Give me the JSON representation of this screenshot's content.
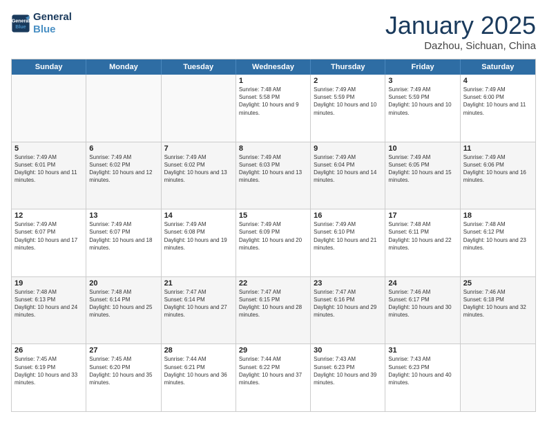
{
  "logo": {
    "line1": "General",
    "line2": "Blue"
  },
  "title": "January 2025",
  "location": "Dazhou, Sichuan, China",
  "header_days": [
    "Sunday",
    "Monday",
    "Tuesday",
    "Wednesday",
    "Thursday",
    "Friday",
    "Saturday"
  ],
  "rows": [
    [
      {
        "day": "",
        "sunrise": "",
        "sunset": "",
        "daylight": ""
      },
      {
        "day": "",
        "sunrise": "",
        "sunset": "",
        "daylight": ""
      },
      {
        "day": "",
        "sunrise": "",
        "sunset": "",
        "daylight": ""
      },
      {
        "day": "1",
        "sunrise": "Sunrise: 7:48 AM",
        "sunset": "Sunset: 5:58 PM",
        "daylight": "Daylight: 10 hours and 9 minutes."
      },
      {
        "day": "2",
        "sunrise": "Sunrise: 7:49 AM",
        "sunset": "Sunset: 5:59 PM",
        "daylight": "Daylight: 10 hours and 10 minutes."
      },
      {
        "day": "3",
        "sunrise": "Sunrise: 7:49 AM",
        "sunset": "Sunset: 5:59 PM",
        "daylight": "Daylight: 10 hours and 10 minutes."
      },
      {
        "day": "4",
        "sunrise": "Sunrise: 7:49 AM",
        "sunset": "Sunset: 6:00 PM",
        "daylight": "Daylight: 10 hours and 11 minutes."
      }
    ],
    [
      {
        "day": "5",
        "sunrise": "Sunrise: 7:49 AM",
        "sunset": "Sunset: 6:01 PM",
        "daylight": "Daylight: 10 hours and 11 minutes."
      },
      {
        "day": "6",
        "sunrise": "Sunrise: 7:49 AM",
        "sunset": "Sunset: 6:02 PM",
        "daylight": "Daylight: 10 hours and 12 minutes."
      },
      {
        "day": "7",
        "sunrise": "Sunrise: 7:49 AM",
        "sunset": "Sunset: 6:02 PM",
        "daylight": "Daylight: 10 hours and 13 minutes."
      },
      {
        "day": "8",
        "sunrise": "Sunrise: 7:49 AM",
        "sunset": "Sunset: 6:03 PM",
        "daylight": "Daylight: 10 hours and 13 minutes."
      },
      {
        "day": "9",
        "sunrise": "Sunrise: 7:49 AM",
        "sunset": "Sunset: 6:04 PM",
        "daylight": "Daylight: 10 hours and 14 minutes."
      },
      {
        "day": "10",
        "sunrise": "Sunrise: 7:49 AM",
        "sunset": "Sunset: 6:05 PM",
        "daylight": "Daylight: 10 hours and 15 minutes."
      },
      {
        "day": "11",
        "sunrise": "Sunrise: 7:49 AM",
        "sunset": "Sunset: 6:06 PM",
        "daylight": "Daylight: 10 hours and 16 minutes."
      }
    ],
    [
      {
        "day": "12",
        "sunrise": "Sunrise: 7:49 AM",
        "sunset": "Sunset: 6:07 PM",
        "daylight": "Daylight: 10 hours and 17 minutes."
      },
      {
        "day": "13",
        "sunrise": "Sunrise: 7:49 AM",
        "sunset": "Sunset: 6:07 PM",
        "daylight": "Daylight: 10 hours and 18 minutes."
      },
      {
        "day": "14",
        "sunrise": "Sunrise: 7:49 AM",
        "sunset": "Sunset: 6:08 PM",
        "daylight": "Daylight: 10 hours and 19 minutes."
      },
      {
        "day": "15",
        "sunrise": "Sunrise: 7:49 AM",
        "sunset": "Sunset: 6:09 PM",
        "daylight": "Daylight: 10 hours and 20 minutes."
      },
      {
        "day": "16",
        "sunrise": "Sunrise: 7:49 AM",
        "sunset": "Sunset: 6:10 PM",
        "daylight": "Daylight: 10 hours and 21 minutes."
      },
      {
        "day": "17",
        "sunrise": "Sunrise: 7:48 AM",
        "sunset": "Sunset: 6:11 PM",
        "daylight": "Daylight: 10 hours and 22 minutes."
      },
      {
        "day": "18",
        "sunrise": "Sunrise: 7:48 AM",
        "sunset": "Sunset: 6:12 PM",
        "daylight": "Daylight: 10 hours and 23 minutes."
      }
    ],
    [
      {
        "day": "19",
        "sunrise": "Sunrise: 7:48 AM",
        "sunset": "Sunset: 6:13 PM",
        "daylight": "Daylight: 10 hours and 24 minutes."
      },
      {
        "day": "20",
        "sunrise": "Sunrise: 7:48 AM",
        "sunset": "Sunset: 6:14 PM",
        "daylight": "Daylight: 10 hours and 25 minutes."
      },
      {
        "day": "21",
        "sunrise": "Sunrise: 7:47 AM",
        "sunset": "Sunset: 6:14 PM",
        "daylight": "Daylight: 10 hours and 27 minutes."
      },
      {
        "day": "22",
        "sunrise": "Sunrise: 7:47 AM",
        "sunset": "Sunset: 6:15 PM",
        "daylight": "Daylight: 10 hours and 28 minutes."
      },
      {
        "day": "23",
        "sunrise": "Sunrise: 7:47 AM",
        "sunset": "Sunset: 6:16 PM",
        "daylight": "Daylight: 10 hours and 29 minutes."
      },
      {
        "day": "24",
        "sunrise": "Sunrise: 7:46 AM",
        "sunset": "Sunset: 6:17 PM",
        "daylight": "Daylight: 10 hours and 30 minutes."
      },
      {
        "day": "25",
        "sunrise": "Sunrise: 7:46 AM",
        "sunset": "Sunset: 6:18 PM",
        "daylight": "Daylight: 10 hours and 32 minutes."
      }
    ],
    [
      {
        "day": "26",
        "sunrise": "Sunrise: 7:45 AM",
        "sunset": "Sunset: 6:19 PM",
        "daylight": "Daylight: 10 hours and 33 minutes."
      },
      {
        "day": "27",
        "sunrise": "Sunrise: 7:45 AM",
        "sunset": "Sunset: 6:20 PM",
        "daylight": "Daylight: 10 hours and 35 minutes."
      },
      {
        "day": "28",
        "sunrise": "Sunrise: 7:44 AM",
        "sunset": "Sunset: 6:21 PM",
        "daylight": "Daylight: 10 hours and 36 minutes."
      },
      {
        "day": "29",
        "sunrise": "Sunrise: 7:44 AM",
        "sunset": "Sunset: 6:22 PM",
        "daylight": "Daylight: 10 hours and 37 minutes."
      },
      {
        "day": "30",
        "sunrise": "Sunrise: 7:43 AM",
        "sunset": "Sunset: 6:23 PM",
        "daylight": "Daylight: 10 hours and 39 minutes."
      },
      {
        "day": "31",
        "sunrise": "Sunrise: 7:43 AM",
        "sunset": "Sunset: 6:23 PM",
        "daylight": "Daylight: 10 hours and 40 minutes."
      },
      {
        "day": "",
        "sunrise": "",
        "sunset": "",
        "daylight": ""
      }
    ]
  ]
}
